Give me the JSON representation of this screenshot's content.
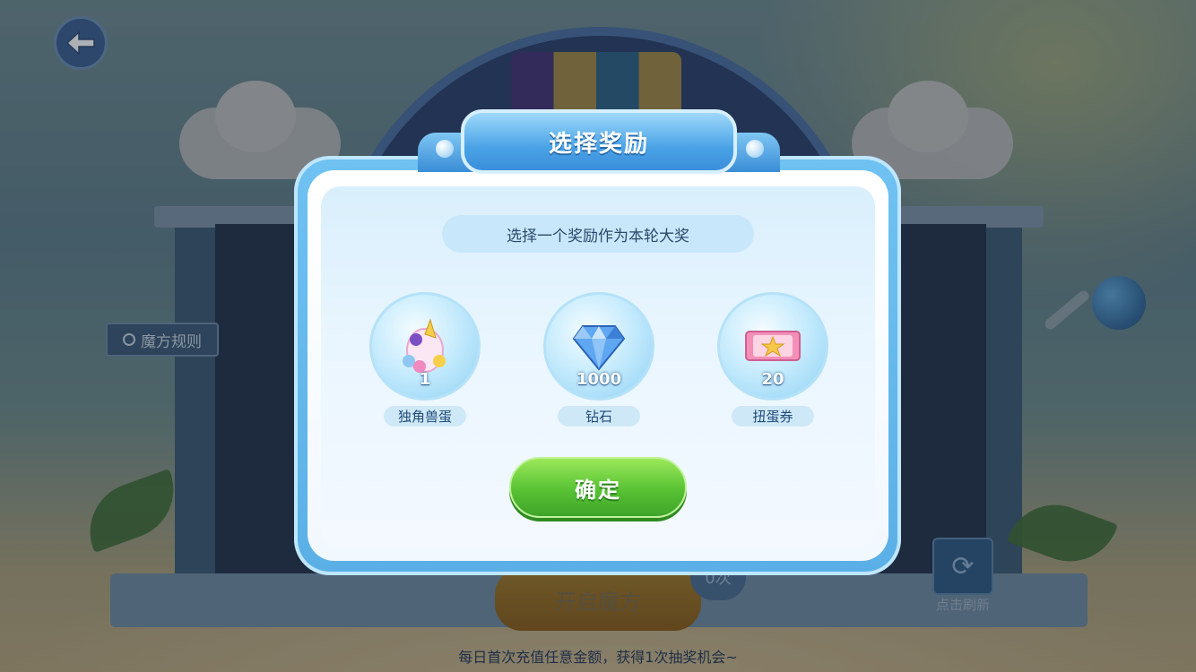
{
  "background": {
    "rules_label": "魔方规则",
    "open_button_label": "开启魔方",
    "remaining_count_label": "0次",
    "refresh_label": "点击刷新",
    "refresh_icon": "refresh-cube-icon",
    "back_icon": "back-arrow-icon",
    "footer_text": "每日首次充值任意金额，获得1次抽奖机会~"
  },
  "dialog": {
    "title": "选择奖励",
    "subtitle": "选择一个奖励作为本轮大奖",
    "rewards": [
      {
        "name": "独角兽蛋",
        "quantity": "1",
        "icon": "unicorn-egg-icon"
      },
      {
        "name": "钻石",
        "quantity": "1000",
        "icon": "diamond-icon"
      },
      {
        "name": "扭蛋券",
        "quantity": "20",
        "icon": "gacha-ticket-icon"
      }
    ],
    "confirm_label": "确定"
  },
  "colors": {
    "dialog_frame": "#5ab0e6",
    "title_badge": "#4aa3e6",
    "confirm_green": "#57c233",
    "label_text": "#1f4a78"
  }
}
